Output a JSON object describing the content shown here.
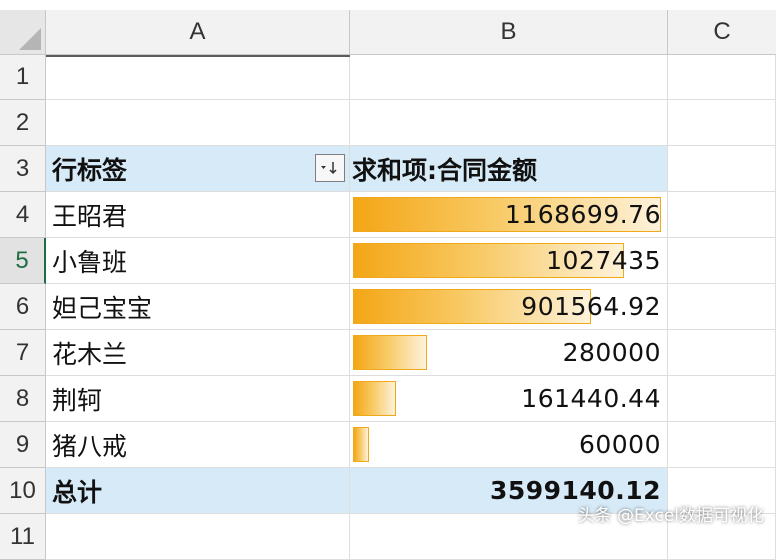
{
  "columns": [
    "A",
    "B",
    "C"
  ],
  "rows": [
    "1",
    "2",
    "3",
    "4",
    "5",
    "6",
    "7",
    "8",
    "9",
    "10",
    "11"
  ],
  "pivot": {
    "header_label": "行标签",
    "header_value": "求和项:合同金额",
    "items": [
      {
        "name": "王昭君",
        "value": "1168699.76",
        "amount": 1168699.76
      },
      {
        "name": "小鲁班",
        "value": "1027435",
        "amount": 1027435
      },
      {
        "name": "妲己宝宝",
        "value": "901564.92",
        "amount": 901564.92
      },
      {
        "name": "花木兰",
        "value": "280000",
        "amount": 280000
      },
      {
        "name": "荆轲",
        "value": "161440.44",
        "amount": 161440.44
      },
      {
        "name": "猪八戒",
        "value": "60000",
        "amount": 60000
      }
    ],
    "total_label": "总计",
    "total_value": "3599140.12"
  },
  "bar_color": "#f4a616",
  "header_fill": "#d6eaf7",
  "watermark": "头条 @Excel数据可视化"
}
